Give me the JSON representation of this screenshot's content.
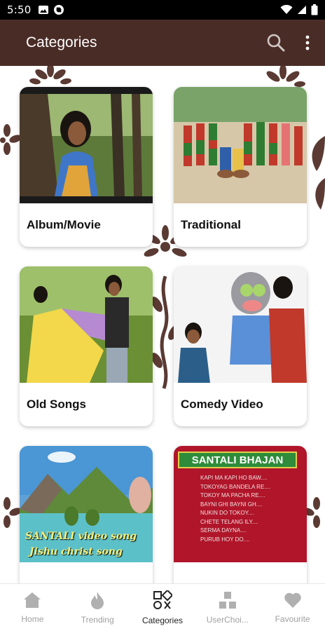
{
  "status": {
    "time": "5:50"
  },
  "appbar": {
    "title": "Categories",
    "search_icon": "search-icon",
    "menu_icon": "more-vert-icon"
  },
  "categories": [
    {
      "label": "Album/Movie"
    },
    {
      "label": "Traditional"
    },
    {
      "label": "Old Songs"
    },
    {
      "label": "Comedy Video"
    },
    {
      "thumb_line1": "SANTALI video song",
      "thumb_line2": "Jishu christ song"
    },
    {
      "thumb_title": "SANTALI BHAJAN",
      "thumb_lines": [
        "KAPI MA KAPI HO BAW....",
        "TOKOYAG BANDELA RE....",
        "TOKOY MA PACHA RE....",
        "BAYNI GHI BAYNI GH....",
        "NUKIN DO TOKOY....",
        "CHETE TELANG ILY....",
        "SERMA DAYNA....",
        "PURUB HOY DO...."
      ]
    }
  ],
  "nav": [
    {
      "label": "Home",
      "icon": "home-icon"
    },
    {
      "label": "Trending",
      "icon": "flame-icon"
    },
    {
      "label": "Categories",
      "icon": "categories-icon"
    },
    {
      "label": "UserChoi...",
      "icon": "user-choice-icon"
    },
    {
      "label": "Favourite",
      "icon": "heart-icon"
    }
  ],
  "colors": {
    "appbar": "#4a2c26",
    "decor": "#5a3a33"
  }
}
